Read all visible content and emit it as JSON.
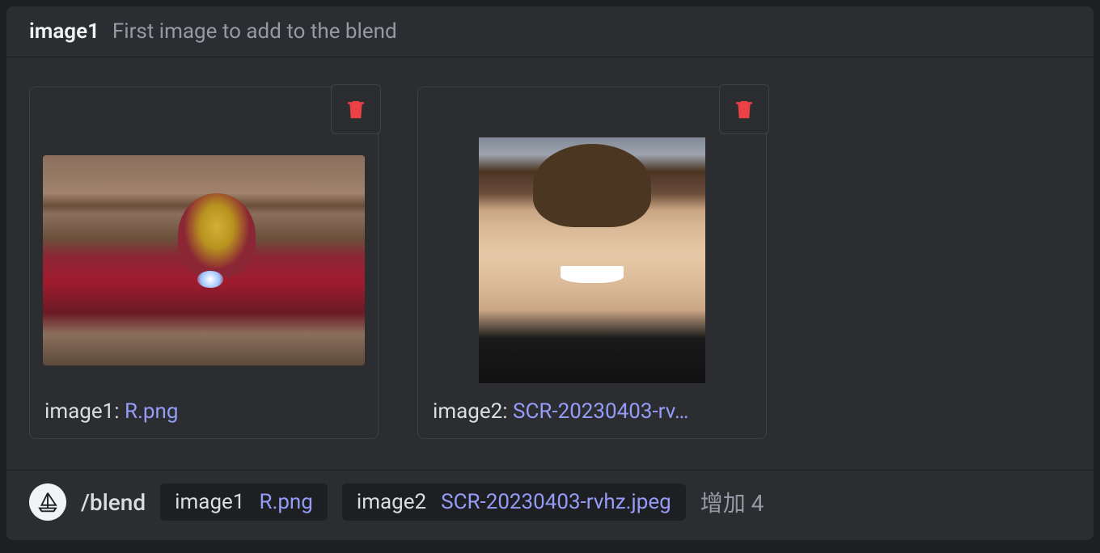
{
  "header": {
    "param_name": "image1",
    "description": "First image to add to the blend"
  },
  "attachments": [
    {
      "param": "image1",
      "filename": "R.png",
      "icon": "trash-icon"
    },
    {
      "param": "image2",
      "filename": "SCR-20230403-rv…",
      "icon": "trash-icon"
    }
  ],
  "command_bar": {
    "command": "/blend",
    "params": [
      {
        "name": "image1",
        "value": "R.png"
      },
      {
        "name": "image2",
        "value": "SCR-20230403-rvhz.jpeg"
      }
    ],
    "add_more": "增加 4"
  },
  "colors": {
    "link": "#949cf7",
    "danger": "#ed4245",
    "bg": "#2b2d31",
    "bg_dark": "#1e1f22"
  }
}
